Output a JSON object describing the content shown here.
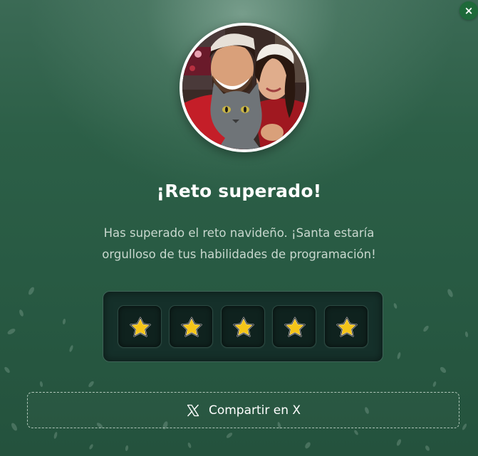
{
  "modal": {
    "close_label": "×",
    "title": "¡Reto superado!",
    "message_line1": "Has superado el reto navideño. ¡Santa estaría",
    "message_line2": "orgulloso de tus habilidades de programación!"
  },
  "rating": {
    "stars_earned": 5,
    "stars_total": 5,
    "star_color": "#f5c518"
  },
  "share": {
    "label": "Compartir en X",
    "icon": "x-logo-icon"
  },
  "colors": {
    "background": "#2c5f47",
    "close_button": "#1e6a3a",
    "panel": "#15302a"
  }
}
